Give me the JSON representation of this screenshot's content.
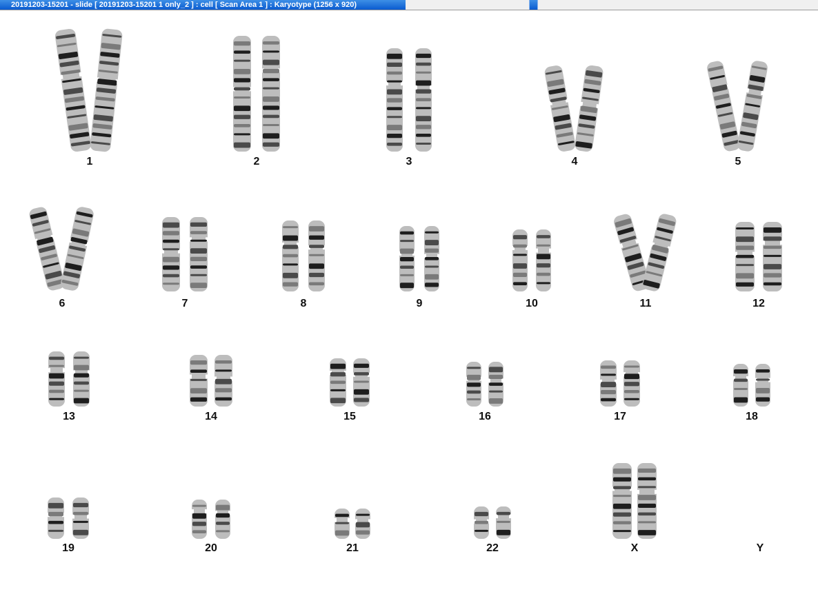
{
  "window": {
    "title": "20191203-15201 - slide [ 20191203-15201 1 only_2 ] : cell [ Scan Area 1 ] : Karyotype  (1256 x 920)"
  },
  "karyotype": {
    "chromosomes": [
      {
        "label": "1"
      },
      {
        "label": "2"
      },
      {
        "label": "3"
      },
      {
        "label": "4"
      },
      {
        "label": "5"
      },
      {
        "label": "6"
      },
      {
        "label": "7"
      },
      {
        "label": "8"
      },
      {
        "label": "9"
      },
      {
        "label": "10"
      },
      {
        "label": "11"
      },
      {
        "label": "12"
      },
      {
        "label": "13"
      },
      {
        "label": "14"
      },
      {
        "label": "15"
      },
      {
        "label": "16"
      },
      {
        "label": "17"
      },
      {
        "label": "18"
      },
      {
        "label": "19"
      },
      {
        "label": "20"
      },
      {
        "label": "21"
      },
      {
        "label": "22"
      },
      {
        "label": "X"
      },
      {
        "label": "Y"
      }
    ]
  }
}
